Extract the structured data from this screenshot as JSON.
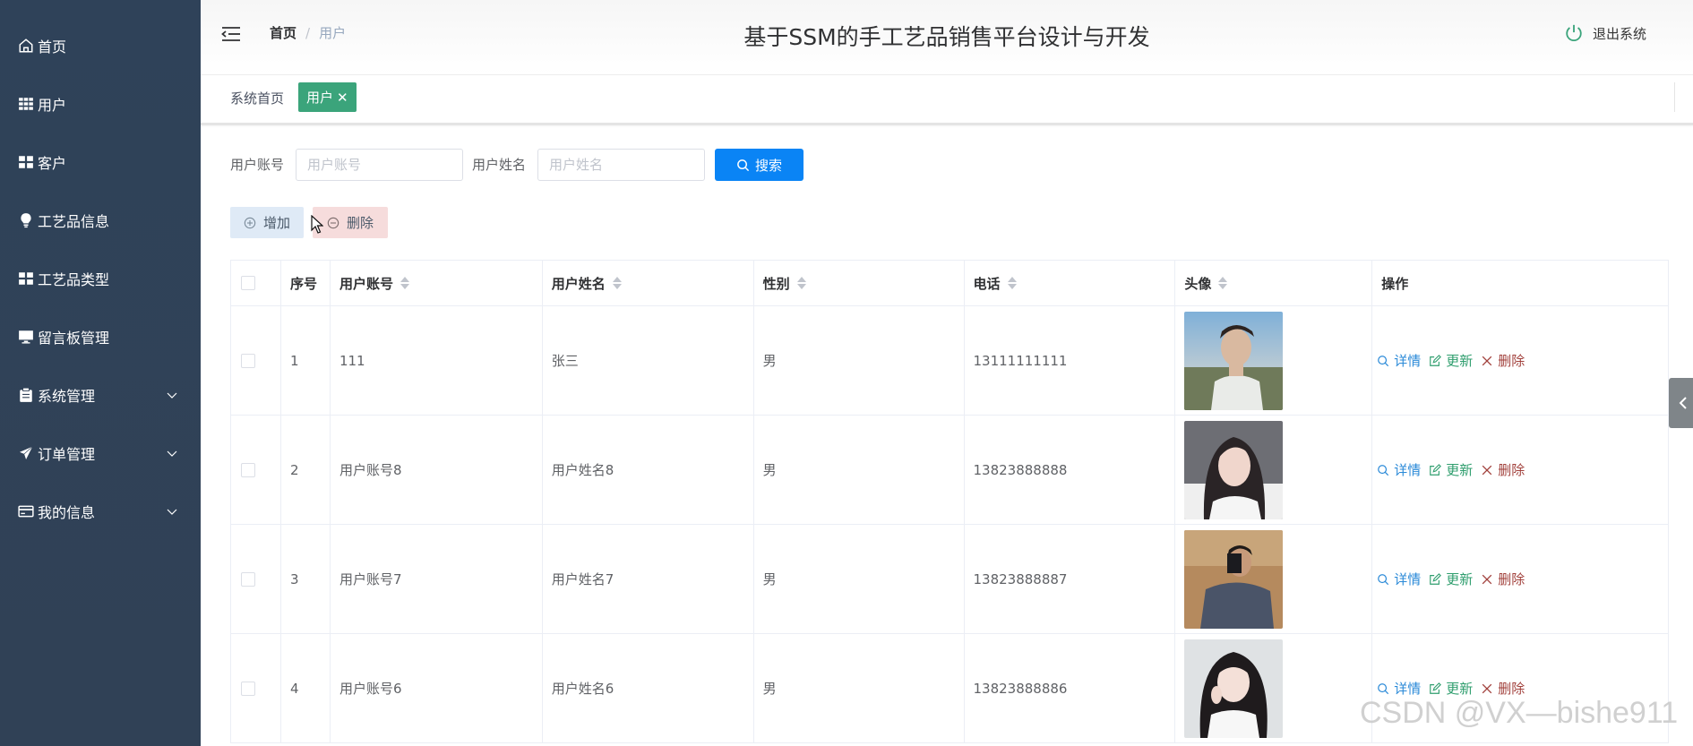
{
  "sidebar": {
    "items": [
      {
        "label": "首页",
        "icon": "home-icon"
      },
      {
        "label": "用户",
        "icon": "grid-icon"
      },
      {
        "label": "客户",
        "icon": "grid-icon"
      },
      {
        "label": "工艺品信息",
        "icon": "bulb-icon"
      },
      {
        "label": "工艺品类型",
        "icon": "grid-icon"
      },
      {
        "label": "留言板管理",
        "icon": "monitor-icon"
      },
      {
        "label": "系统管理",
        "icon": "clipboard-icon",
        "expandable": true
      },
      {
        "label": "订单管理",
        "icon": "send-icon",
        "expandable": true
      },
      {
        "label": "我的信息",
        "icon": "card-icon",
        "expandable": true
      }
    ]
  },
  "header": {
    "breadcrumb_home": "首页",
    "breadcrumb_sep": "/",
    "breadcrumb_current": "用户",
    "title": "基于SSM的手工艺品销售平台设计与开发",
    "logout_label": "退出系统"
  },
  "tags": {
    "home": "系统首页",
    "active": "用户",
    "active_close": "✕"
  },
  "search": {
    "account_label": "用户账号",
    "account_placeholder": "用户账号",
    "name_label": "用户姓名",
    "name_placeholder": "用户姓名",
    "search_button": "搜索"
  },
  "toolbar": {
    "add_label": "增加",
    "delete_label": "删除"
  },
  "table": {
    "columns": [
      "序号",
      "用户账号",
      "用户姓名",
      "性别",
      "电话",
      "头像",
      "操作"
    ],
    "rows": [
      {
        "index": "1",
        "account": "111",
        "name": "张三",
        "gender": "男",
        "phone": "13111111111"
      },
      {
        "index": "2",
        "account": "用户账号8",
        "name": "用户姓名8",
        "gender": "男",
        "phone": "13823888888"
      },
      {
        "index": "3",
        "account": "用户账号7",
        "name": "用户姓名7",
        "gender": "男",
        "phone": "13823888887"
      },
      {
        "index": "4",
        "account": "用户账号6",
        "name": "用户姓名6",
        "gender": "男",
        "phone": "13823888886"
      }
    ],
    "actions": {
      "detail": "详情",
      "update": "更新",
      "delete": "删除"
    }
  },
  "watermark": "CSDN @VX—bishe911",
  "colors": {
    "sidebar_bg": "#304156",
    "tag_active": "#3ba47b",
    "search_btn": "#0a84f5",
    "add_btn_bg": "#dfeaf6",
    "del_btn_bg": "#f6dcdc",
    "detail": "#2b8ad8",
    "update": "#2f9e6e",
    "delete": "#a2413c"
  }
}
